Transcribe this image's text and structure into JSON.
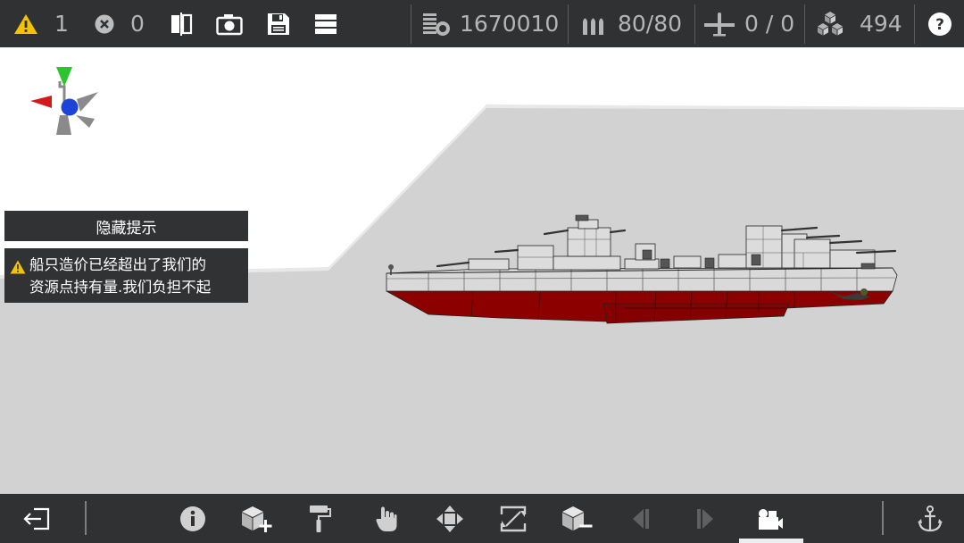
{
  "topbar": {
    "warnings": "1",
    "errors": "0",
    "resources": "1670010",
    "ammo": "80/80",
    "aircraft": "0 / 0",
    "parts": "494"
  },
  "panel": {
    "hide_hints_label": "隐藏提示",
    "warning_line1": "船只造价已经超出了我们的",
    "warning_line2": "资源点持有量.我们负担不起"
  },
  "icons": {
    "warning": "warning-icon",
    "error": "error-icon",
    "mirror": "mirror-icon",
    "camera": "camera-icon",
    "save": "save-icon",
    "menu": "menu-icon",
    "resources": "resource-coins-icon",
    "ammo": "ammo-icon",
    "aircraft": "aircraft-icon",
    "parts": "blocks-icon",
    "help": "help-icon"
  },
  "colors": {
    "toolbar": "#2f3133",
    "hull_red": "#8c0000",
    "hull_grey": "#d8d8d8",
    "ground": "#d2d2d2",
    "warning": "#f3c300"
  }
}
